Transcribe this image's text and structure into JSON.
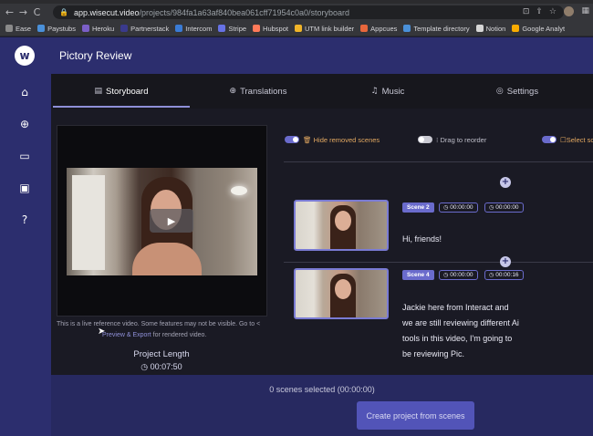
{
  "browser": {
    "url_host": "app.wisecut.video",
    "url_path": "/projects/984fa1a63af840bea061cff71954c0a0/storyboard",
    "nav": {
      "back": "←",
      "forward": "→",
      "reload": "C"
    },
    "bookmarks": [
      {
        "label": "Ease",
        "color": "#8a8a8a"
      },
      {
        "label": "Paystubs",
        "color": "#4a90d9"
      },
      {
        "label": "Heroku",
        "color": "#7b5fc7"
      },
      {
        "label": "Partnerstack",
        "color": "#3a3a8c"
      },
      {
        "label": "Intercom",
        "color": "#3a7bd5"
      },
      {
        "label": "Stripe",
        "color": "#6772e5"
      },
      {
        "label": "Hubspot",
        "color": "#ff7a59"
      },
      {
        "label": "UTM link builder",
        "color": "#f0b429"
      },
      {
        "label": "Appcues",
        "color": "#e8673c"
      },
      {
        "label": "Template directory",
        "color": "#4a90d9"
      },
      {
        "label": "Notion",
        "color": "#d6d6d6"
      },
      {
        "label": "Google Analyt",
        "color": "#f9ab00"
      }
    ]
  },
  "app": {
    "logo_letter": "w",
    "title": "Pictory Review"
  },
  "sidebar": {
    "icons": [
      {
        "name": "home-icon",
        "glyph": "⌂"
      },
      {
        "name": "add-circle-icon",
        "glyph": "⊕"
      },
      {
        "name": "folder-icon",
        "glyph": "▭"
      },
      {
        "name": "video-library-icon",
        "glyph": "▣"
      },
      {
        "name": "help-icon",
        "glyph": "?"
      }
    ]
  },
  "tabs": [
    {
      "label": "Storyboard",
      "icon": "▤",
      "active": true
    },
    {
      "label": "Translations",
      "icon": "⊕",
      "active": false
    },
    {
      "label": "Music",
      "icon": "♫",
      "active": false
    },
    {
      "label": "Settings",
      "icon": "◎",
      "active": false
    }
  ],
  "video": {
    "play_glyph": "▶",
    "note_text": "This is a live reference video. Some features may not be visible. Go to",
    "note_icon": "<",
    "note_link": "Preview & Export",
    "note_suffix": "for rendered video.",
    "project_length_label": "Project Length",
    "project_length_value": "00:07:50",
    "clock_glyph": "◷"
  },
  "controls": {
    "hide_removed": {
      "label": "Hide removed scenes",
      "icon": "🗑",
      "on": true
    },
    "drag_reorder": {
      "label": "Drag to reorder",
      "icon": "⁝",
      "on": false
    },
    "select_scenes": {
      "label": "Select sc",
      "icon": "☐",
      "on": true
    }
  },
  "scenes": [
    {
      "badge": "Scene 2",
      "start": "00:00:00",
      "end": "00:00:00",
      "text": "Hi, friends!"
    },
    {
      "badge": "Scene 4",
      "start": "00:00:00",
      "end": "00:00:16",
      "text": "Jackie here from Interact and we are still reviewing different Ai tools in this video, I'm going to be reviewing Pic."
    }
  ],
  "footer": {
    "selected_text": "0 scenes selected (00:00:00)",
    "create_button": "Create project from scenes"
  },
  "plus_glyph": "+"
}
